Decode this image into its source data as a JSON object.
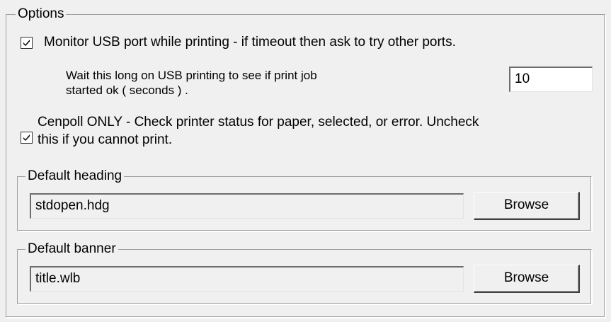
{
  "options_group": {
    "legend": "Options",
    "monitor_usb": {
      "checked": true,
      "label": "Monitor USB port while printing - if timeout then ask  to try other ports."
    },
    "wait_usb": {
      "label_line1": "Wait this long on USB printing to see if print job",
      "label_line2": "started ok ( seconds ) .",
      "value": "10"
    },
    "cenpoll": {
      "checked": true,
      "label_line1": "Cenpoll ONLY - Check printer status for paper, selected, or error.  Uncheck",
      "label_line2": "this if you cannot print."
    },
    "default_heading": {
      "legend": "Default heading",
      "value": "stdopen.hdg",
      "browse_label": "Browse"
    },
    "default_banner": {
      "legend": "Default banner",
      "value": "title.wlb",
      "browse_label": "Browse"
    }
  }
}
